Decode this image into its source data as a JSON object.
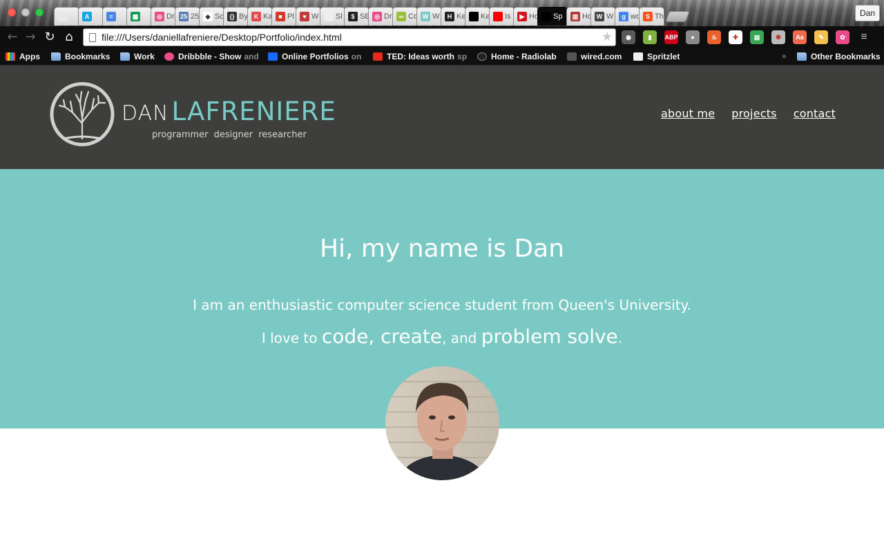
{
  "browser": {
    "tabs": [
      {
        "label": "",
        "color": "#e8e8e8",
        "glyph": ""
      },
      {
        "label": "",
        "color": "#1aa4e8",
        "glyph": "A"
      },
      {
        "label": "",
        "color": "#4a86e8",
        "glyph": "≡"
      },
      {
        "label": "",
        "color": "#0f9d58",
        "glyph": "▦"
      },
      {
        "label": "Dr",
        "color": "#ea4c89",
        "glyph": "◎"
      },
      {
        "label": "25",
        "color": "#5b7fb3",
        "glyph": "25"
      },
      {
        "label": "Sc",
        "color": "#ffffff",
        "glyph": "◆"
      },
      {
        "label": "By",
        "color": "#333333",
        "glyph": "{}"
      },
      {
        "label": "Ka",
        "color": "#e24b4b",
        "glyph": "K"
      },
      {
        "label": "Pl",
        "color": "#d33a2c",
        "glyph": "■"
      },
      {
        "label": "W",
        "color": "#c23a3a",
        "glyph": "♥"
      },
      {
        "label": "Sl",
        "color": "#eeeeee",
        "glyph": ""
      },
      {
        "label": "SE",
        "color": "#222222",
        "glyph": "$"
      },
      {
        "label": "Dr",
        "color": "#ea4c89",
        "glyph": "◎"
      },
      {
        "label": "Co",
        "color": "#9bbf3a",
        "glyph": "∞"
      },
      {
        "label": "W",
        "color": "#7ac9c5",
        "glyph": "W"
      },
      {
        "label": "Ke",
        "color": "#222222",
        "glyph": "H"
      },
      {
        "label": "Ke",
        "color": "#000000",
        "glyph": ""
      },
      {
        "label": "Is",
        "color": "#ff0000",
        "glyph": ""
      },
      {
        "label": "Ho",
        "color": "#cc181e",
        "glyph": "▶"
      },
      {
        "label": "Sp",
        "color": "#000000",
        "glyph": "",
        "active": true
      },
      {
        "label": "Ho",
        "color": "#b23a3a",
        "glyph": "▥"
      },
      {
        "label": "W",
        "color": "#464646",
        "glyph": "W"
      },
      {
        "label": "wo",
        "color": "#4285f4",
        "glyph": "g"
      },
      {
        "label": "Th",
        "color": "#f4511e",
        "glyph": "S"
      }
    ],
    "profile_name": "Dan",
    "url": "file:///Users/daniellafreniere/Desktop/Portfolio/index.html",
    "bookmarks": [
      {
        "label": "Apps",
        "type": "apps"
      },
      {
        "label": "Bookmarks",
        "type": "folder"
      },
      {
        "label": "Work",
        "type": "folder"
      },
      {
        "label": "Dribbble - Show",
        "dim": "and",
        "type": "dribbble"
      },
      {
        "label": "Online Portfolios",
        "dim": "on",
        "type": "behance"
      },
      {
        "label": "TED: Ideas worth",
        "dim": "sp",
        "type": "ted"
      },
      {
        "label": "Home - Radiolab",
        "type": "radiolab"
      },
      {
        "label": "wired.com",
        "type": "wired"
      },
      {
        "label": "Spritzlet",
        "type": "page"
      }
    ],
    "overflow_label": "»",
    "other_bookmarks": "Other Bookmarks",
    "extensions": [
      {
        "name": "grammarly-icon",
        "color": "#5a5a5a",
        "glyph": "◉"
      },
      {
        "name": "evernote-icon",
        "color": "#7fb241",
        "glyph": "▮"
      },
      {
        "name": "adblock-icon",
        "color": "#d0021b",
        "glyph": "ABP"
      },
      {
        "name": "record-icon",
        "color": "#8a8a8a",
        "glyph": "●"
      },
      {
        "name": "flame-icon",
        "color": "#e8632b",
        "glyph": "♨"
      },
      {
        "name": "health-icon",
        "color": "#ffffff",
        "glyph": "✚"
      },
      {
        "name": "sheets-icon",
        "color": "#3aa757",
        "glyph": "▤"
      },
      {
        "name": "wheel-icon",
        "color": "#bbbbbb",
        "glyph": "✺"
      },
      {
        "name": "translate-icon",
        "color": "#f06a50",
        "glyph": "Aa"
      },
      {
        "name": "notes-icon",
        "color": "#f4c04e",
        "glyph": "✎"
      },
      {
        "name": "colorpicker-icon",
        "color": "#e84a8a",
        "glyph": "✿"
      },
      {
        "name": "menu-icon",
        "color": "#bdbdbd",
        "glyph": "≡"
      }
    ]
  },
  "site": {
    "logo_first": "DAN",
    "logo_last": "LAFRENIERE",
    "tagline": "programmer designer researcher",
    "nav": [
      "about me",
      "projects",
      "contact"
    ],
    "hero": {
      "title": "Hi, my name is Dan",
      "line1": "I am an enthusiastic computer science student from Queen's University.",
      "line2_a": "I love to ",
      "line2_b": "code, create",
      "line2_c": ", and ",
      "line2_d": "problem solve",
      "line2_e": "."
    }
  },
  "colors": {
    "header_bg": "#3e3e3c",
    "hero_bg": "#7ac9c5",
    "accent": "#78cbc6"
  }
}
